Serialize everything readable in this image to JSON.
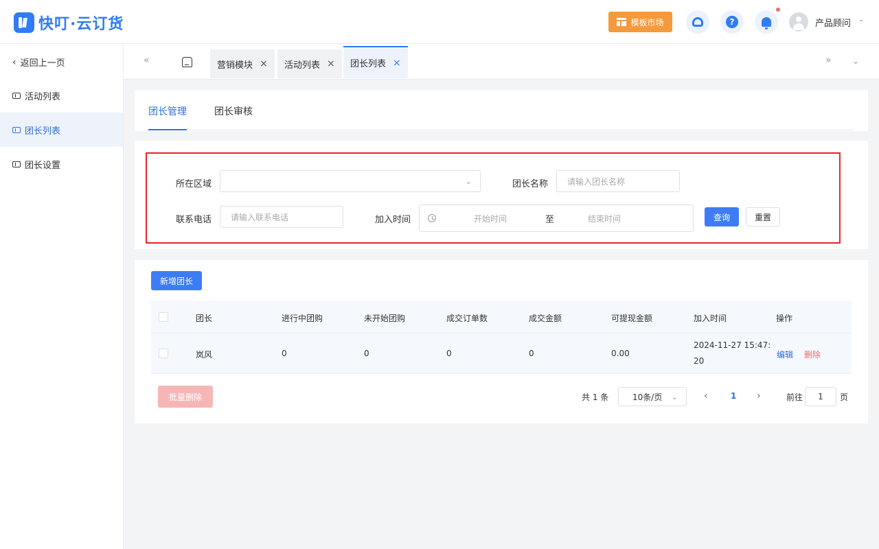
{
  "app": {
    "title": "快叮·云订货"
  },
  "header": {
    "template_market": "模板市场",
    "user_name": "产品顾问",
    "help_glyph": "?"
  },
  "sidebar": {
    "back": "返回上一页",
    "items": [
      {
        "label": "活动列表",
        "active": false
      },
      {
        "label": "团长列表",
        "active": true
      },
      {
        "label": "团长设置",
        "active": false
      }
    ]
  },
  "tabs": [
    {
      "label": "营销模块"
    },
    {
      "label": "活动列表"
    },
    {
      "label": "团长列表",
      "active": true
    }
  ],
  "subtabs": [
    {
      "label": "团长管理",
      "active": true
    },
    {
      "label": "团长审核"
    }
  ],
  "filters": {
    "region_label": "所在区域",
    "region_value": "",
    "leader_name_label": "团长名称",
    "leader_name_placeholder": "请输入团长名称",
    "phone_label": "联系电话",
    "phone_placeholder": "请输入联系电话",
    "join_time_label": "加入时间",
    "start_placeholder": "开始时间",
    "range_separator": "至",
    "end_placeholder": "结束时间",
    "query_button": "查询",
    "reset_button": "重置"
  },
  "toolbar": {
    "add_button": "新增团长"
  },
  "table": {
    "columns": [
      "团长",
      "进行中团购",
      "未开始团购",
      "成交订单数",
      "成交金额",
      "可提现金额",
      "加入时间",
      "操作"
    ],
    "rows": [
      {
        "leader": "岚风",
        "ongoing": "0",
        "not_started": "0",
        "orders": "0",
        "amount": "0",
        "withdrawable": "0.00",
        "join_time_line1": "2024-11-27 15:47:",
        "join_time_line2": "20",
        "edit": "编辑",
        "delete": "删除"
      }
    ]
  },
  "footer": {
    "batch_delete": "批量删除",
    "total": "共 1 条",
    "page_size": "10条/页",
    "current_page": "1",
    "goto_label": "前往",
    "goto_value": "1",
    "page_unit": "页"
  },
  "colors": {
    "primary": "#2f7cf6",
    "template_button": "#f59a3c",
    "danger": "#f56c6c",
    "highlight_box": "#e8232b"
  }
}
